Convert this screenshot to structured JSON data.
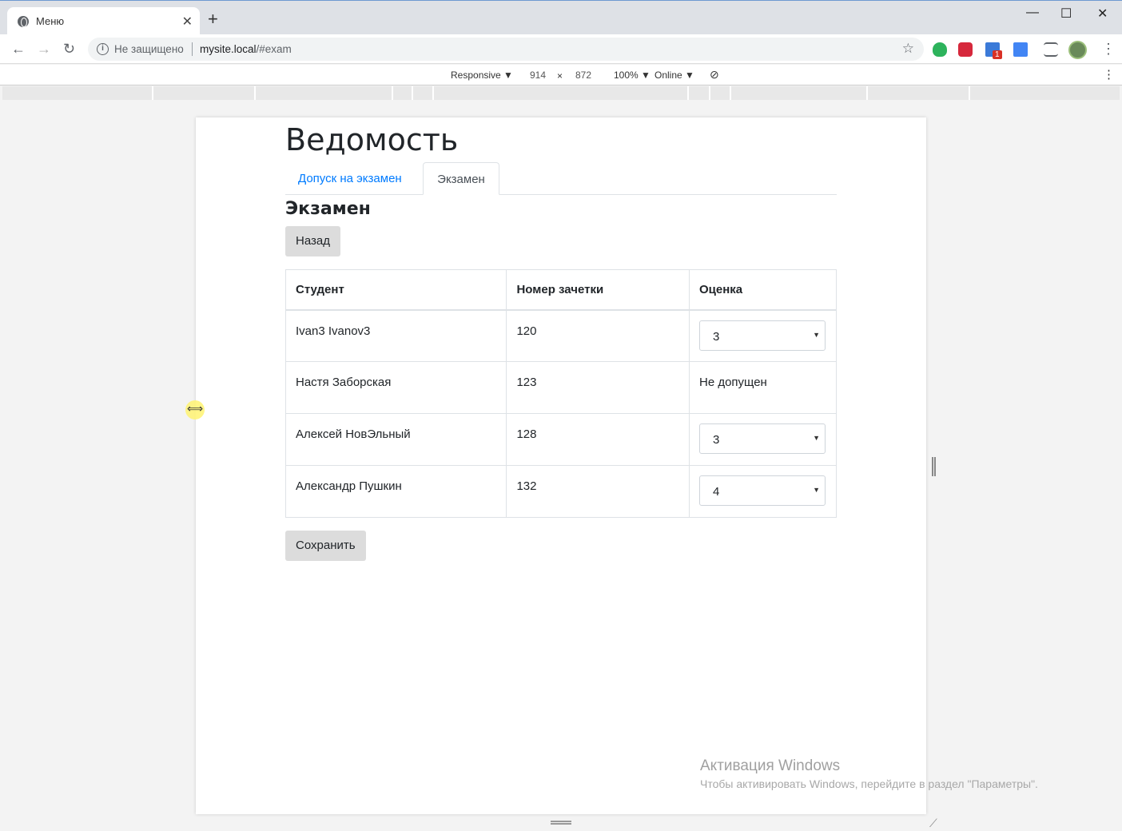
{
  "browser": {
    "tab_title": "Меню",
    "tab_close": "✕",
    "new_tab": "+",
    "security_text": "Не защищено",
    "url_host": "mysite.local",
    "url_rest": "/#exam",
    "extension_badge": "1"
  },
  "devtools": {
    "device": "Responsive ▼",
    "width": "914",
    "times": "×",
    "height": "872",
    "zoom": "100% ▼",
    "network": "Online ▼"
  },
  "page": {
    "title": "Ведомость",
    "tabs": [
      {
        "label": "Допуск на экзамен"
      },
      {
        "label": "Экзамен"
      }
    ],
    "section_title": "Экзамен",
    "back_label": "Назад",
    "save_label": "Сохранить",
    "table": {
      "headers": [
        "Студент",
        "Номер зачетки",
        "Оценка"
      ],
      "rows": [
        {
          "student": "Ivan3 Ivanov3",
          "record": "120",
          "grade": "3",
          "has_select": true
        },
        {
          "student": "Настя Заборская",
          "record": "123",
          "grade": "Не допущен",
          "has_select": false
        },
        {
          "student": "Алексей НовЭльный",
          "record": "128",
          "grade": "3",
          "has_select": true
        },
        {
          "student": "Александр Пушкин",
          "record": "132",
          "grade": "4",
          "has_select": true
        }
      ]
    }
  },
  "watermark": {
    "line1": "Активация Windows",
    "line2": "Чтобы активировать Windows, перейдите в раздел \"Параметры\"."
  },
  "colors": {
    "link": "#007bff",
    "button_bg": "#dcdcdc"
  }
}
